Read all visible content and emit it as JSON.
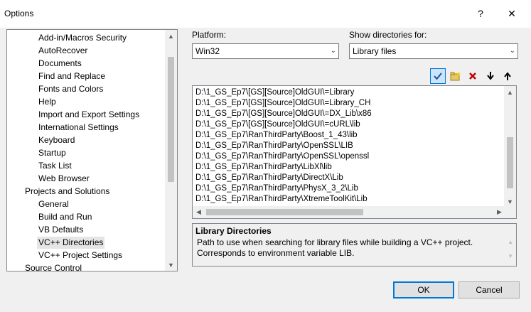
{
  "window": {
    "title": "Options",
    "help_glyph": "?",
    "close_glyph": "✕"
  },
  "tree": {
    "items": [
      {
        "label": "Add-in/Macros Security",
        "level": 1
      },
      {
        "label": "AutoRecover",
        "level": 1
      },
      {
        "label": "Documents",
        "level": 1
      },
      {
        "label": "Find and Replace",
        "level": 1
      },
      {
        "label": "Fonts and Colors",
        "level": 1
      },
      {
        "label": "Help",
        "level": 1
      },
      {
        "label": "Import and Export Settings",
        "level": 1
      },
      {
        "label": "International Settings",
        "level": 1
      },
      {
        "label": "Keyboard",
        "level": 1
      },
      {
        "label": "Startup",
        "level": 1
      },
      {
        "label": "Task List",
        "level": 1
      },
      {
        "label": "Web Browser",
        "level": 1
      },
      {
        "label": "Projects and Solutions",
        "level": 0
      },
      {
        "label": "General",
        "level": 1
      },
      {
        "label": "Build and Run",
        "level": 1
      },
      {
        "label": "VB Defaults",
        "level": 1
      },
      {
        "label": "VC++ Directories",
        "level": 1,
        "selected": true
      },
      {
        "label": "VC++ Project Settings",
        "level": 1
      },
      {
        "label": "Source Control",
        "level": 0
      }
    ]
  },
  "platform": {
    "label": "Platform:",
    "value": "Win32"
  },
  "show_dirs": {
    "label": "Show directories for:",
    "value": "Library files"
  },
  "toolbar": {
    "icons": [
      "check-icon",
      "new-folder-icon",
      "delete-icon",
      "move-down-icon",
      "move-up-icon"
    ]
  },
  "directories": [
    "D:\\1_GS_Ep7\\[GS][Source]OldGUI\\=Library",
    "D:\\1_GS_Ep7\\[GS][Source]OldGUI\\=Library_CH",
    "D:\\1_GS_Ep7\\[GS][Source]OldGUI\\=DX_Lib\\x86",
    "D:\\1_GS_Ep7\\[GS][Source]OldGUI\\=cURL\\lib",
    "D:\\1_GS_Ep7\\RanThirdParty\\Boost_1_43\\lib",
    "D:\\1_GS_Ep7\\RanThirdParty\\OpenSSL\\LIB",
    "D:\\1_GS_Ep7\\RanThirdParty\\OpenSSL\\openssl",
    "D:\\1_GS_Ep7\\RanThirdParty\\LibXl\\lib",
    "D:\\1_GS_Ep7\\RanThirdParty\\DirectX\\Lib",
    "D:\\1_GS_Ep7\\RanThirdParty\\PhysX_3_2\\Lib",
    "D:\\1_GS_Ep7\\RanThirdParty\\XtremeToolKit\\Lib"
  ],
  "description": {
    "title": "Library Directories",
    "text": "Path to use when searching for library files while building a VC++ project. Corresponds to environment variable LIB."
  },
  "buttons": {
    "ok": "OK",
    "cancel": "Cancel"
  },
  "colors": {
    "accent": "#0078d7"
  }
}
